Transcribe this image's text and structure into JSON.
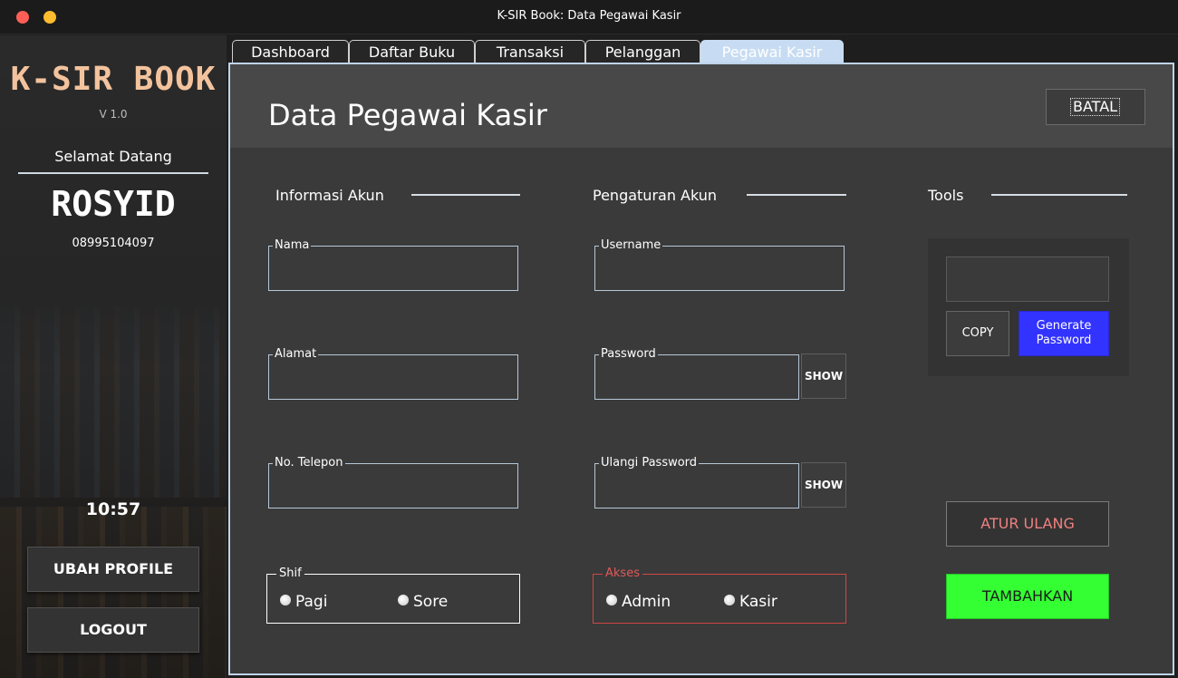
{
  "window": {
    "title": "K-SIR Book: Data Pegawai Kasir"
  },
  "sidebar": {
    "brand": "K-SIR BOOK",
    "version": "V 1.0",
    "welcome": "Selamat Datang",
    "user_name": "ROSYID",
    "user_phone": "08995104097",
    "clock": "10:57",
    "ubah_profile": "UBAH PROFILE",
    "logout": "LOGOUT"
  },
  "tabs": [
    {
      "label": "Dashboard",
      "active": false
    },
    {
      "label": "Daftar Buku",
      "active": false
    },
    {
      "label": "Transaksi",
      "active": false
    },
    {
      "label": "Pelanggan",
      "active": false
    },
    {
      "label": "Pegawai Kasir",
      "active": true
    }
  ],
  "page": {
    "title": "Data Pegawai Kasir",
    "batal": "BATAL"
  },
  "sections": {
    "informasi_akun": "Informasi Akun",
    "pengaturan_akun": "Pengaturan Akun",
    "tools": "Tools"
  },
  "fields": {
    "nama": {
      "label": "Nama",
      "value": ""
    },
    "alamat": {
      "label": "Alamat",
      "value": ""
    },
    "telepon": {
      "label": "No. Telepon",
      "value": ""
    },
    "username": {
      "label": "Username",
      "value": ""
    },
    "password": {
      "label": "Password",
      "value": ""
    },
    "ulangi_password": {
      "label": "Ulangi Password",
      "value": ""
    },
    "generated_password": {
      "value": ""
    }
  },
  "buttons": {
    "show": "SHOW",
    "copy": "COPY",
    "generate_line1": "Generate",
    "generate_line2": "Password",
    "atur_ulang": "ATUR ULANG",
    "tambahkan": "TAMBAHKAN"
  },
  "shif": {
    "label": "Shif",
    "options": [
      "Pagi",
      "Sore"
    ]
  },
  "akses": {
    "label": "Akses",
    "options": [
      "Admin",
      "Kasir"
    ]
  },
  "colors": {
    "brand": "#f3c39d",
    "active_tab": "#c7dcf2",
    "generate_button": "#3333ff",
    "add_button": "#33ff33",
    "reset_text": "#f08080",
    "akses_border": "#d14545"
  }
}
